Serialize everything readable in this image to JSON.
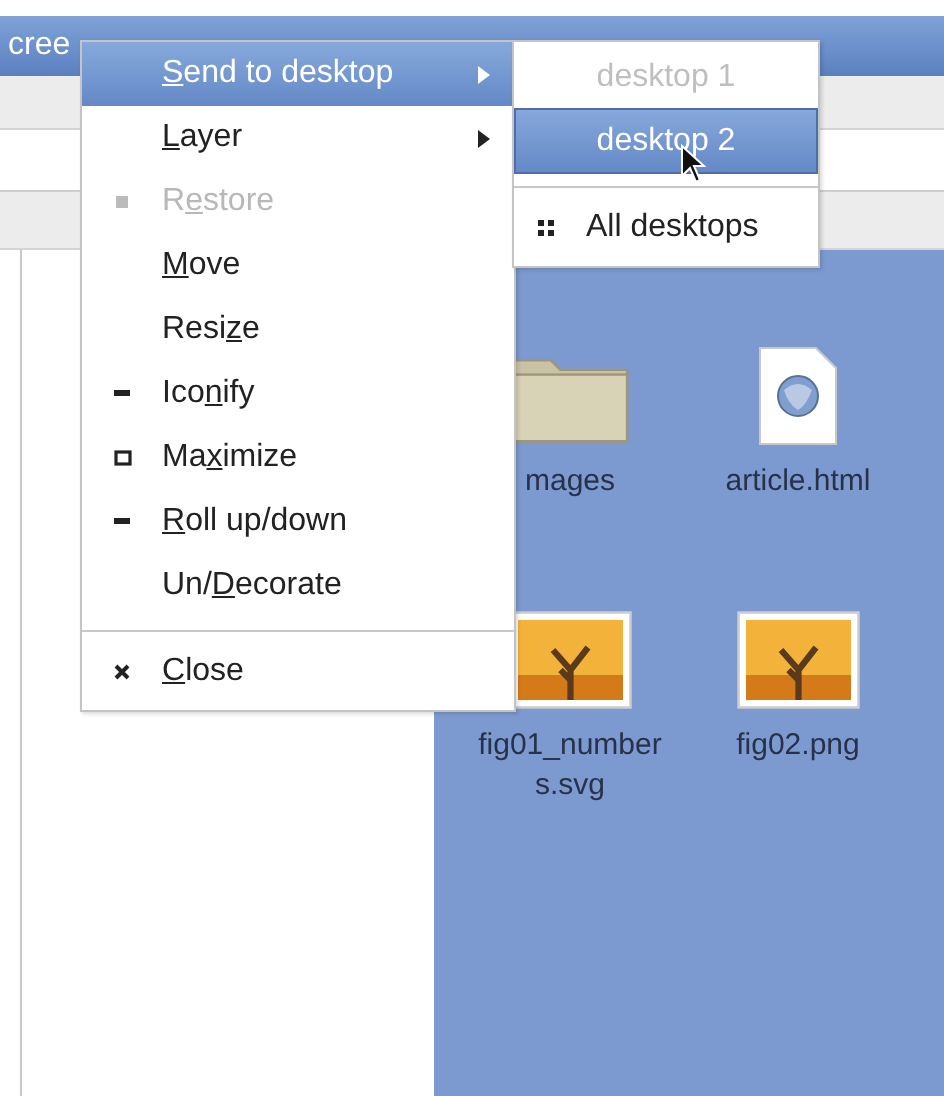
{
  "window": {
    "title": "cree"
  },
  "desktop_items": [
    {
      "name": "mages",
      "kind": "folder"
    },
    {
      "name": "article.html",
      "kind": "web-document"
    },
    {
      "name": "fig01_numbers.svg",
      "kind": "image"
    },
    {
      "name": "fig02.png",
      "kind": "image"
    }
  ],
  "menu": [
    {
      "kind": "plain",
      "label": {
        "key": "S",
        "after": "end to desktop"
      },
      "submenu": true,
      "selected": true,
      "disabled": false
    },
    {
      "kind": "plain",
      "label": {
        "key": "L",
        "after": "ayer"
      },
      "submenu": true,
      "selected": false,
      "disabled": false
    },
    {
      "kind": "restore",
      "label": {
        "before": "R",
        "key": "e",
        "after": "store"
      },
      "submenu": false,
      "selected": false,
      "disabled": true
    },
    {
      "kind": "plain",
      "label": {
        "key": "M",
        "after": "ove"
      },
      "submenu": false,
      "selected": false,
      "disabled": false
    },
    {
      "kind": "plain",
      "label": {
        "before": "Resi",
        "key": "z",
        "after": "e"
      },
      "submenu": false,
      "selected": false,
      "disabled": false
    },
    {
      "kind": "iconify",
      "label": {
        "before": "Ico",
        "key": "n",
        "after": "ify"
      },
      "submenu": false,
      "selected": false,
      "disabled": false
    },
    {
      "kind": "maximize",
      "label": {
        "before": "Ma",
        "key": "x",
        "after": "imize"
      },
      "submenu": false,
      "selected": false,
      "disabled": false
    },
    {
      "kind": "shade",
      "label": {
        "key": "R",
        "after": "oll up/down"
      },
      "submenu": false,
      "selected": false,
      "disabled": false
    },
    {
      "kind": "plain",
      "label": {
        "before": "Un/",
        "key": "D",
        "after": "ecorate"
      },
      "submenu": false,
      "selected": false,
      "disabled": false
    },
    {
      "kind": "separator"
    },
    {
      "kind": "close",
      "label": {
        "key": "C",
        "after": "lose"
      },
      "submenu": false,
      "selected": false,
      "disabled": false
    }
  ],
  "submenu": [
    {
      "kind": "plain",
      "label": "desktop 1",
      "selected": false,
      "disabled": true
    },
    {
      "kind": "plain",
      "label": "desktop 2",
      "selected": true,
      "disabled": false
    },
    {
      "kind": "separator"
    },
    {
      "kind": "all",
      "label": "All desktops",
      "selected": false,
      "disabled": false
    }
  ]
}
